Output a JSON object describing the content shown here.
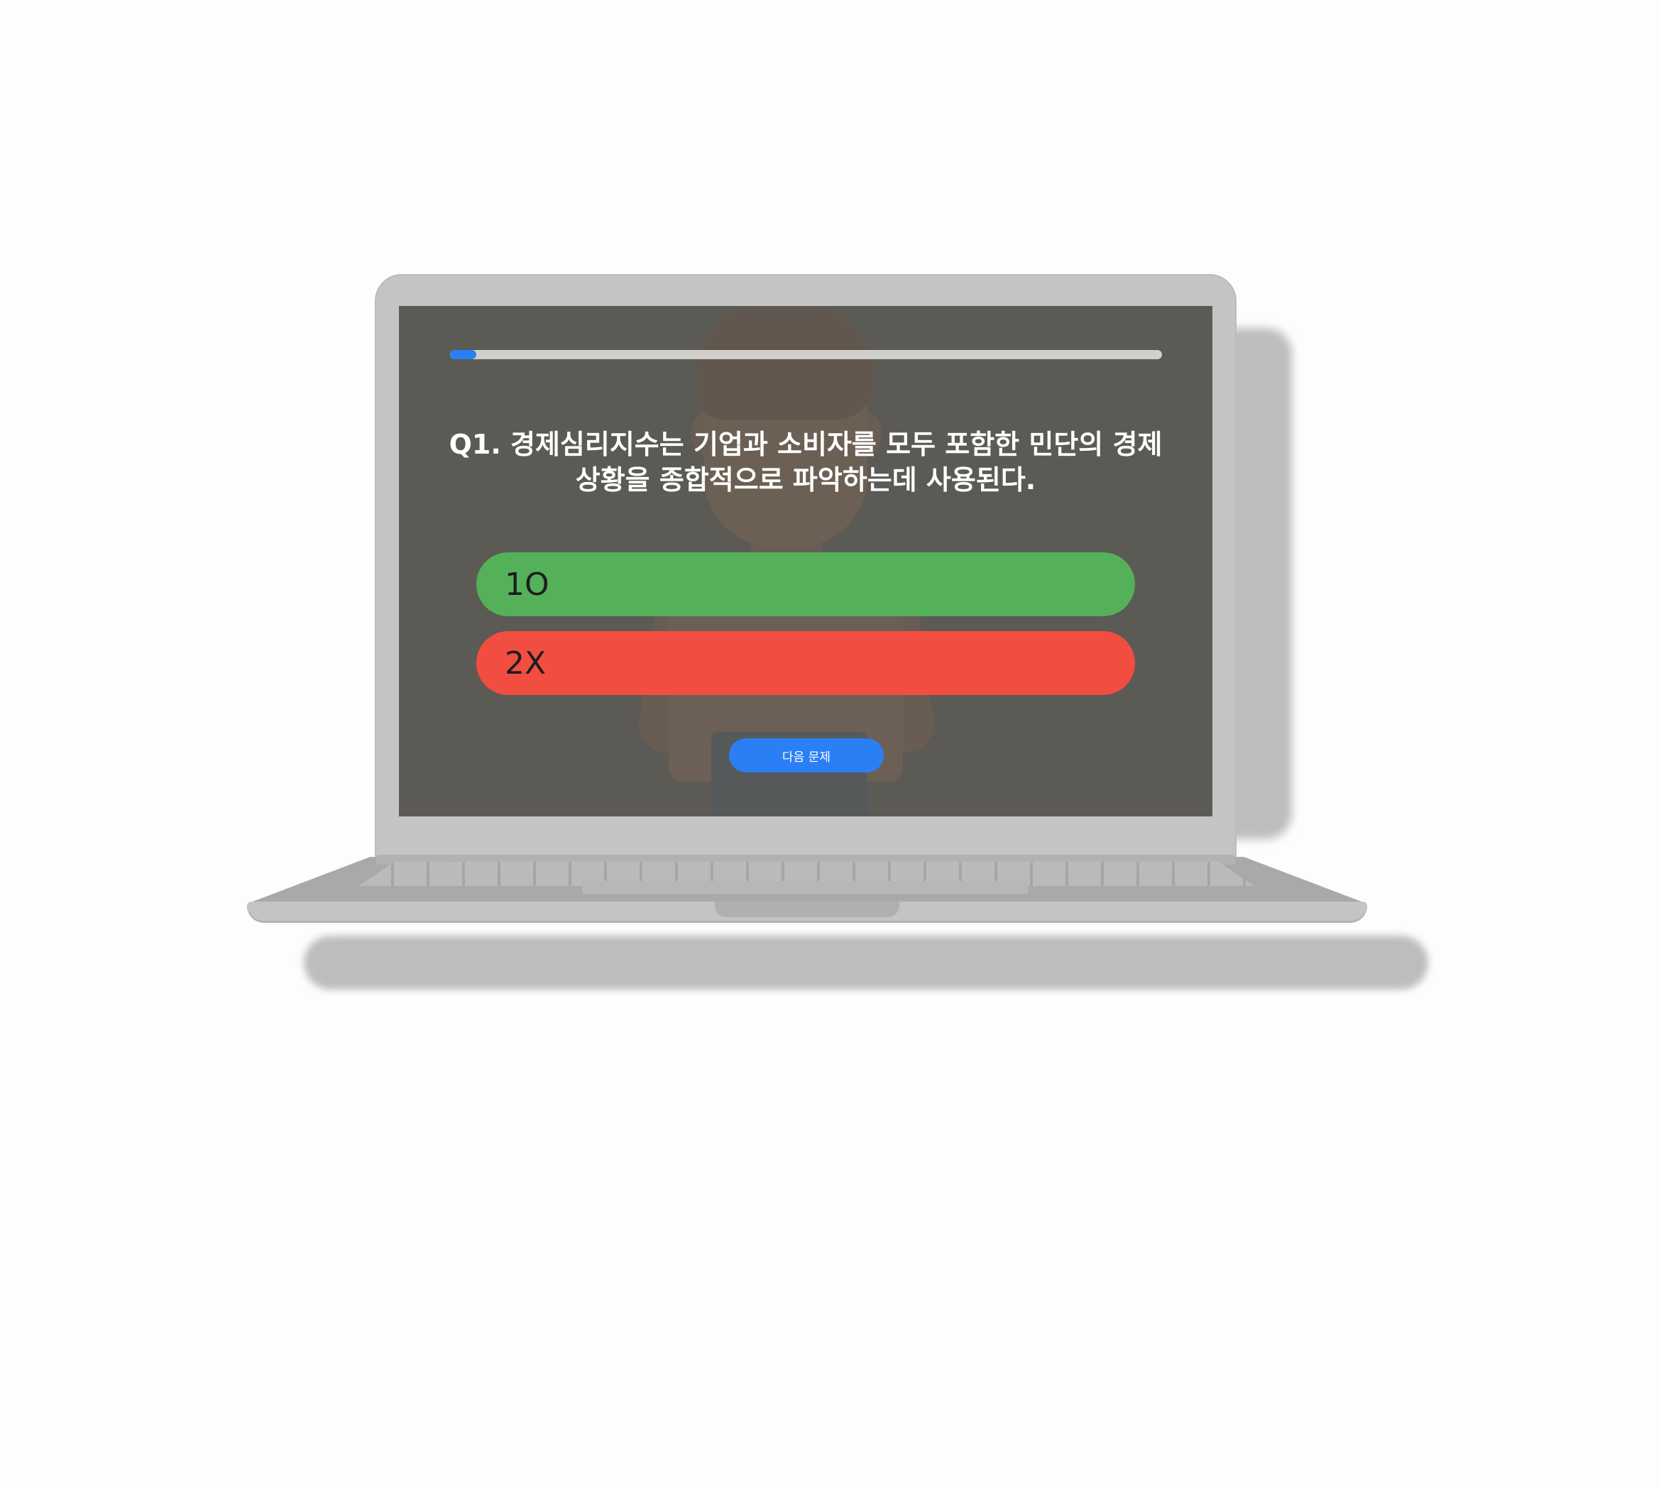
{
  "quiz": {
    "progress": 0.037,
    "question": "Q1. 경제심리지수는 기업과 소비자를 모두 포함한 민단의 경제 상황을 종합적으로 파악하는데 사용된다.",
    "options": [
      {
        "label": "1O",
        "color": "#55b05a"
      },
      {
        "label": "2X",
        "color": "#f14e41"
      }
    ],
    "next_label": "다음 문제",
    "next_color": "#2a7ff5",
    "progress_color": "#2a7ff5"
  }
}
